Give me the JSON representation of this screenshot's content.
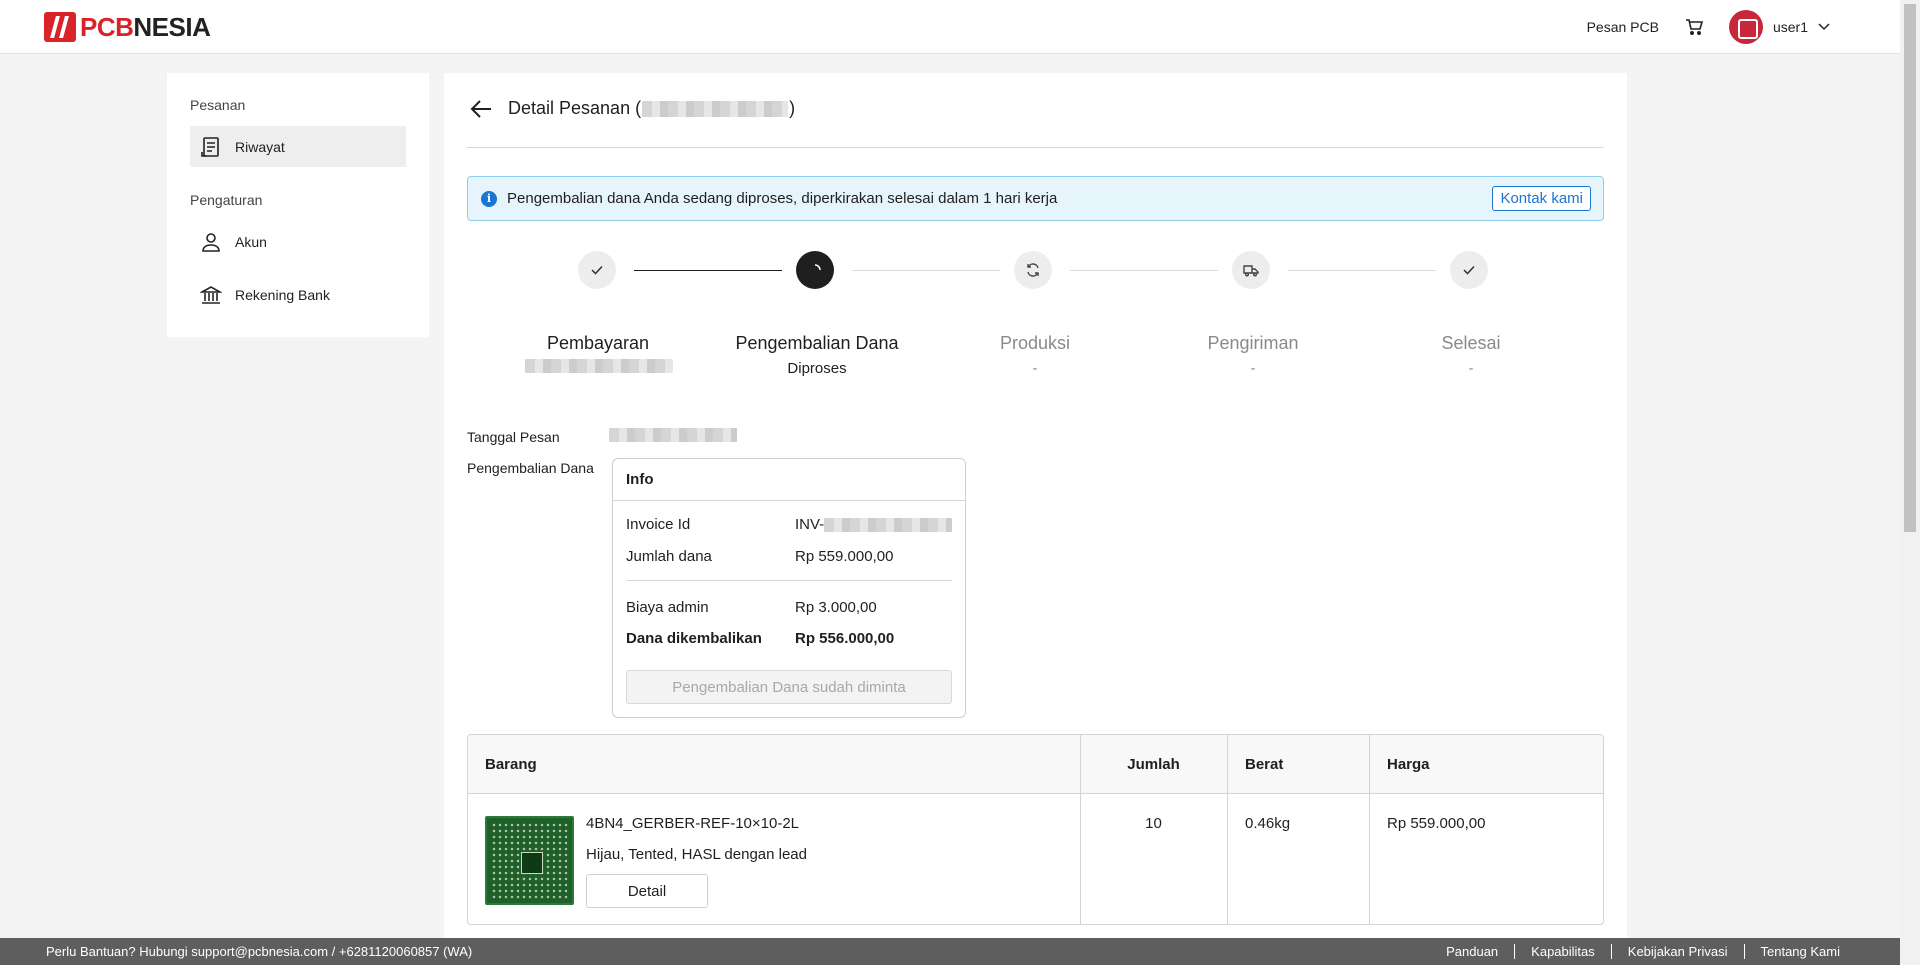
{
  "header": {
    "logo_pcb": "PCB",
    "logo_nesia": "NESIA",
    "nav_order_pcb": "Pesan PCB",
    "user_name": "user1"
  },
  "sidebar": {
    "group_orders": "Pesanan",
    "item_history": "Riwayat",
    "group_settings": "Pengaturan",
    "item_account": "Akun",
    "item_bank": "Rekening Bank"
  },
  "main": {
    "title_prefix": "Detail Pesanan (",
    "title_suffix": ")",
    "alert_text": "Pengembalian dana Anda sedang diproses, diperkirakan selesai dalam 1 hari kerja",
    "alert_button": "Kontak kami",
    "steps": [
      {
        "label": "Pembayaran",
        "sub": ""
      },
      {
        "label": "Pengembalian Dana",
        "sub": "Diproses"
      },
      {
        "label": "Produksi",
        "sub": "-"
      },
      {
        "label": "Pengiriman",
        "sub": "-"
      },
      {
        "label": "Selesai",
        "sub": "-"
      }
    ],
    "order_date_label": "Tanggal Pesan",
    "refund_label": "Pengembalian Dana",
    "info": {
      "title": "Info",
      "invoice_label": "Invoice Id",
      "invoice_prefix": "INV-",
      "amount_label": "Jumlah dana",
      "amount_value": "Rp 559.000,00",
      "admin_label": "Biaya admin",
      "admin_value": "Rp 3.000,00",
      "refund_label": "Dana dikembalikan",
      "refund_value": "Rp 556.000,00",
      "button": "Pengembalian Dana sudah diminta"
    },
    "table": {
      "headers": [
        "Barang",
        "Jumlah",
        "Berat",
        "Harga"
      ],
      "rows": [
        {
          "name": "4BN4_GERBER-REF-10×10-2L",
          "spec": "Hijau, Tented, HASL dengan lead",
          "detail_button": "Detail",
          "qty": "10",
          "weight": "0.46kg",
          "price": "Rp 559.000,00"
        }
      ]
    }
  },
  "footer": {
    "help_text": "Perlu Bantuan? Hubungi  support@pcbnesia.com  /  +6281120060857 (WA)",
    "links": [
      "Panduan",
      "Kapabilitas",
      "Kebijakan Privasi",
      "Tentang Kami"
    ]
  }
}
